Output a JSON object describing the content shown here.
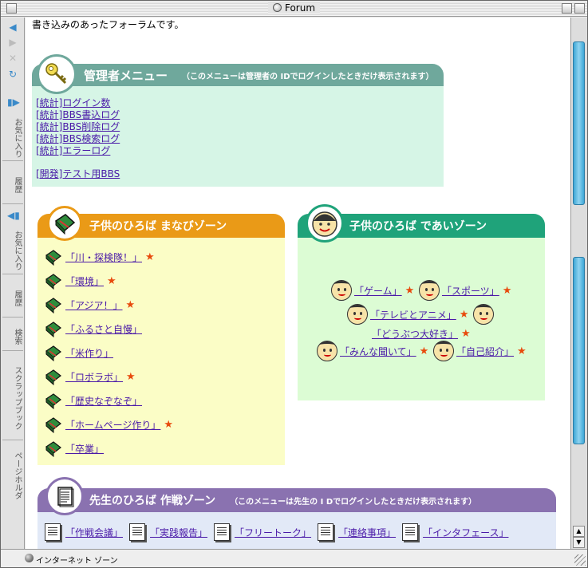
{
  "window": {
    "title": "Forum"
  },
  "sidebar": {
    "tabs": [
      "お気に入り",
      "履歴",
      "お気に入り",
      "履歴",
      "検索",
      "スクラップブック",
      "ページホルダ"
    ]
  },
  "intro": "書き込みのあったフォーラムです。",
  "admin": {
    "title": "管理者メニュー",
    "note": "（このメニューは管理者の IDでログインしたときだけ表示されます）",
    "links": [
      "[統計]ログイン数",
      "[統計]BBS書込ログ",
      "[統計]BBS削除ログ",
      "[統計]BBS検索ログ",
      "[統計]エラーログ"
    ],
    "dev_link": "[開発]テスト用BBS"
  },
  "manabi": {
    "title": "子供のひろば まなびゾーン",
    "items": [
      "「川・探検隊！」",
      "「環境」",
      "「アジア！」",
      "「ふるさと自慢」",
      "「米作り」",
      "「ロボラボ」",
      "「歴史なぞなぞ」",
      "「ホームページ作り」",
      "「卒業」"
    ],
    "starred": [
      true,
      true,
      true,
      false,
      false,
      true,
      false,
      true,
      false
    ]
  },
  "deai": {
    "title": "子供のひろば であいゾーン",
    "items": [
      "「ゲーム」",
      "「スポーツ」",
      "「テレビとアニメ」",
      "「どうぶつ大好き」",
      "「みんな聞いて」",
      "「自己紹介」"
    ]
  },
  "sensei": {
    "title": "先生のひろば 作戦ゾーン",
    "note": "（このメニューは先生の I Dでログインしたときだけ表示されます）",
    "items": [
      "「作戦会議」",
      "「実践報告」",
      "「フリートーク」",
      "「連絡事項」",
      "「インタフェース」"
    ]
  },
  "status": {
    "text": "インターネット ゾーン"
  },
  "colors": {
    "admin_header": "#6fa89c",
    "admin_body": "#d6f5e6",
    "manabi_header": "#ea9a17",
    "manabi_body": "#fbfdc6",
    "deai_header": "#1fa37a",
    "deai_body": "#dcfcd4",
    "sensei_header": "#8a72b0",
    "sensei_body": "#e2e9f7",
    "star": "#e84a0c",
    "link": "#4a1aa8"
  }
}
